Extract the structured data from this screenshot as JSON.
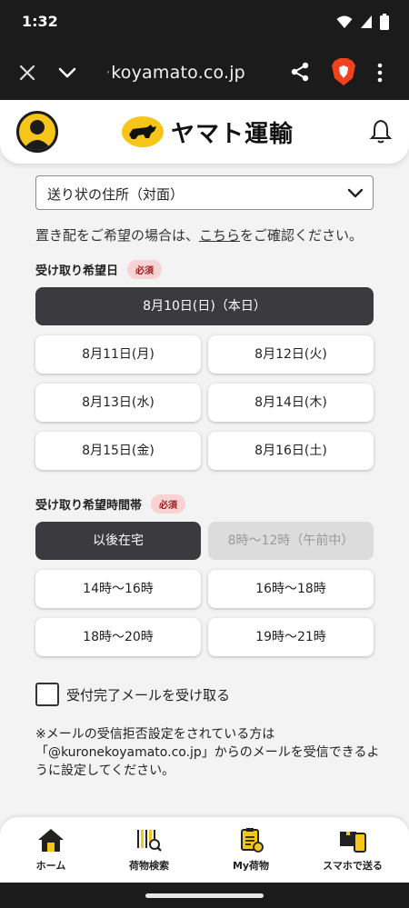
{
  "status_bar": {
    "time": "1:32"
  },
  "browser": {
    "url_faded": "·",
    "url": "koyamato.co.jp"
  },
  "header": {
    "logo_text": "ヤマト運輸"
  },
  "address_select": {
    "value": "送り状の住所（対面）"
  },
  "notice": {
    "prefix": "置き配をご希望の場合は、",
    "link": "こちら",
    "suffix": "をご確認ください。"
  },
  "date_section": {
    "label": "受け取り希望日",
    "required": "必須",
    "options": [
      "8月10日(日)（本日）",
      "8月11日(月)",
      "8月12日(火)",
      "8月13日(水)",
      "8月14日(木)",
      "8月15日(金)",
      "8月16日(土)"
    ],
    "selected_index": 0
  },
  "time_section": {
    "label": "受け取り希望時間帯",
    "required": "必須",
    "options": [
      "以後在宅",
      "8時〜12時（午前中）",
      "14時〜16時",
      "16時〜18時",
      "18時〜20時",
      "19時〜21時"
    ],
    "selected_index": 0,
    "disabled_index": 1
  },
  "email_checkbox": {
    "label": "受付完了メールを受け取る",
    "checked": false
  },
  "mail_note": "※メールの受信拒否設定をされている方は「@kuronekoyamato.co.jp」からのメールを受信できるように設定してください。",
  "bottom_nav": [
    {
      "label": "ホーム",
      "icon": "home-icon"
    },
    {
      "label": "荷物検索",
      "icon": "barcode-search-icon"
    },
    {
      "label": "My荷物",
      "icon": "my-package-icon"
    },
    {
      "label": "スマホで送る",
      "icon": "phone-package-icon"
    }
  ],
  "colors": {
    "brand_yellow": "#f6c51a",
    "selected": "#3b3b3f",
    "required_bg": "#f8d3d3"
  }
}
